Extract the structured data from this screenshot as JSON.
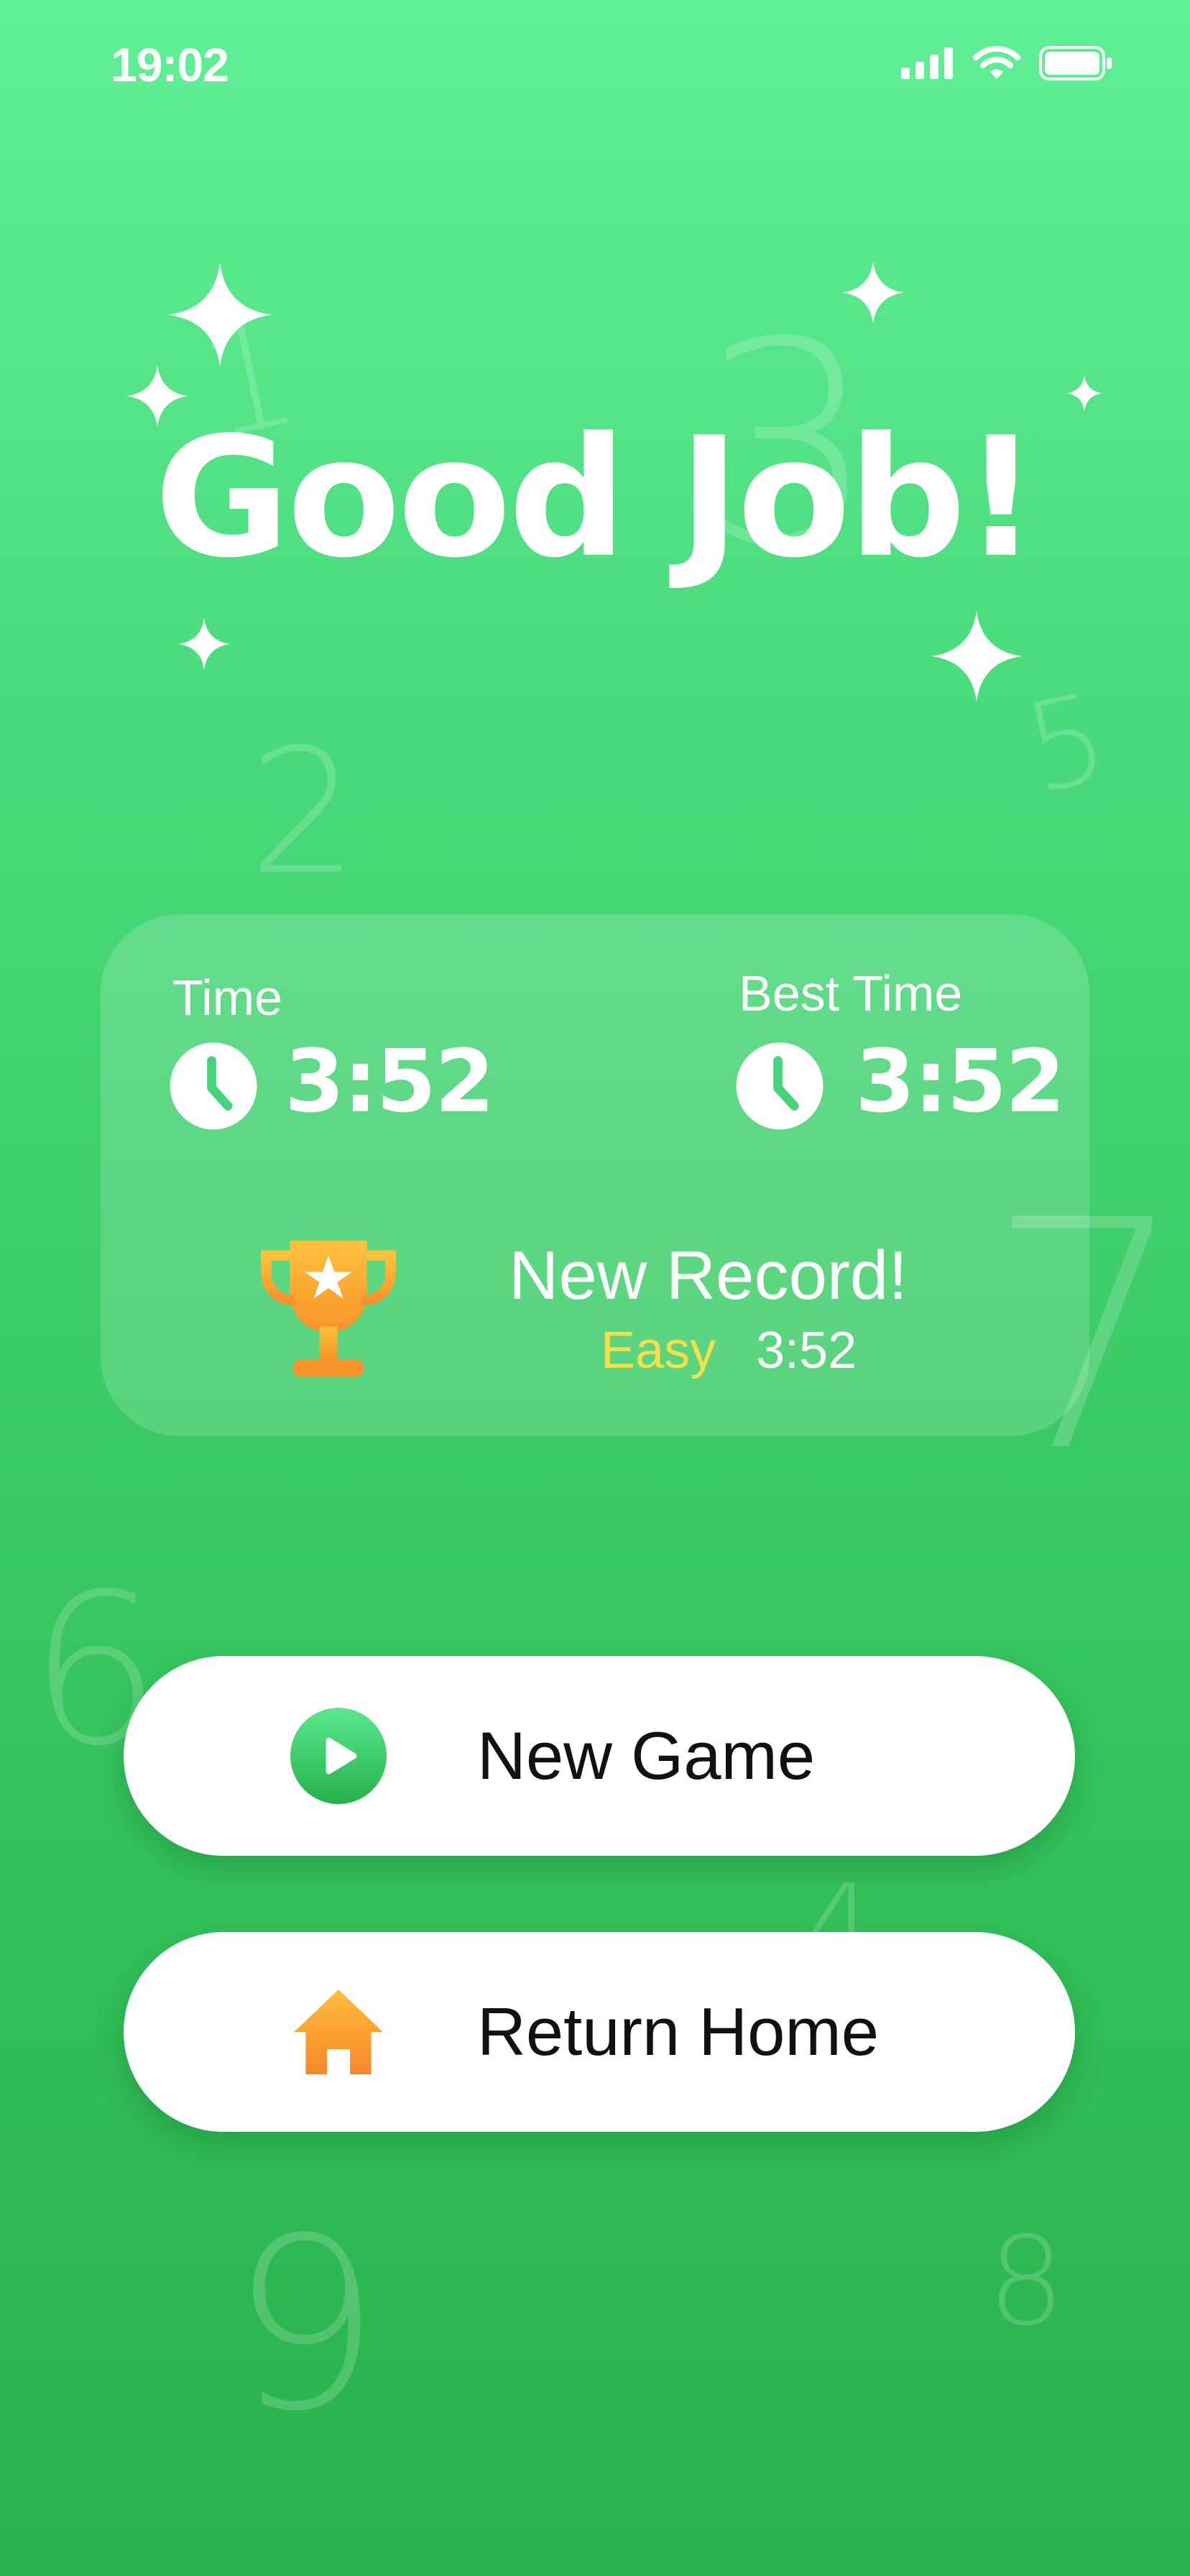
{
  "status_bar": {
    "time": "19:02"
  },
  "background_numbers": [
    "1",
    "3",
    "5",
    "2",
    "7",
    "6",
    "4",
    "9",
    "8"
  ],
  "title": "Good Job!",
  "stats": {
    "time_label": "Time",
    "time_value": "3:52",
    "best_label": "Best Time",
    "best_value": "3:52"
  },
  "record": {
    "title": "New Record!",
    "difficulty": "Easy",
    "time": "3:52"
  },
  "buttons": {
    "new_game": "New Game",
    "return_home": "Return Home"
  },
  "colors": {
    "background_top": "#62F096",
    "background_bottom": "#2AB24C",
    "difficulty_easy": "#F4E04D",
    "trophy": "#F7A633",
    "home": "#F7922B",
    "play_button": "#2FC25A"
  },
  "icons": [
    "signal-icon",
    "wifi-icon",
    "battery-icon",
    "clock-icon",
    "trophy-icon",
    "play-icon",
    "home-icon",
    "sparkle-icon"
  ]
}
